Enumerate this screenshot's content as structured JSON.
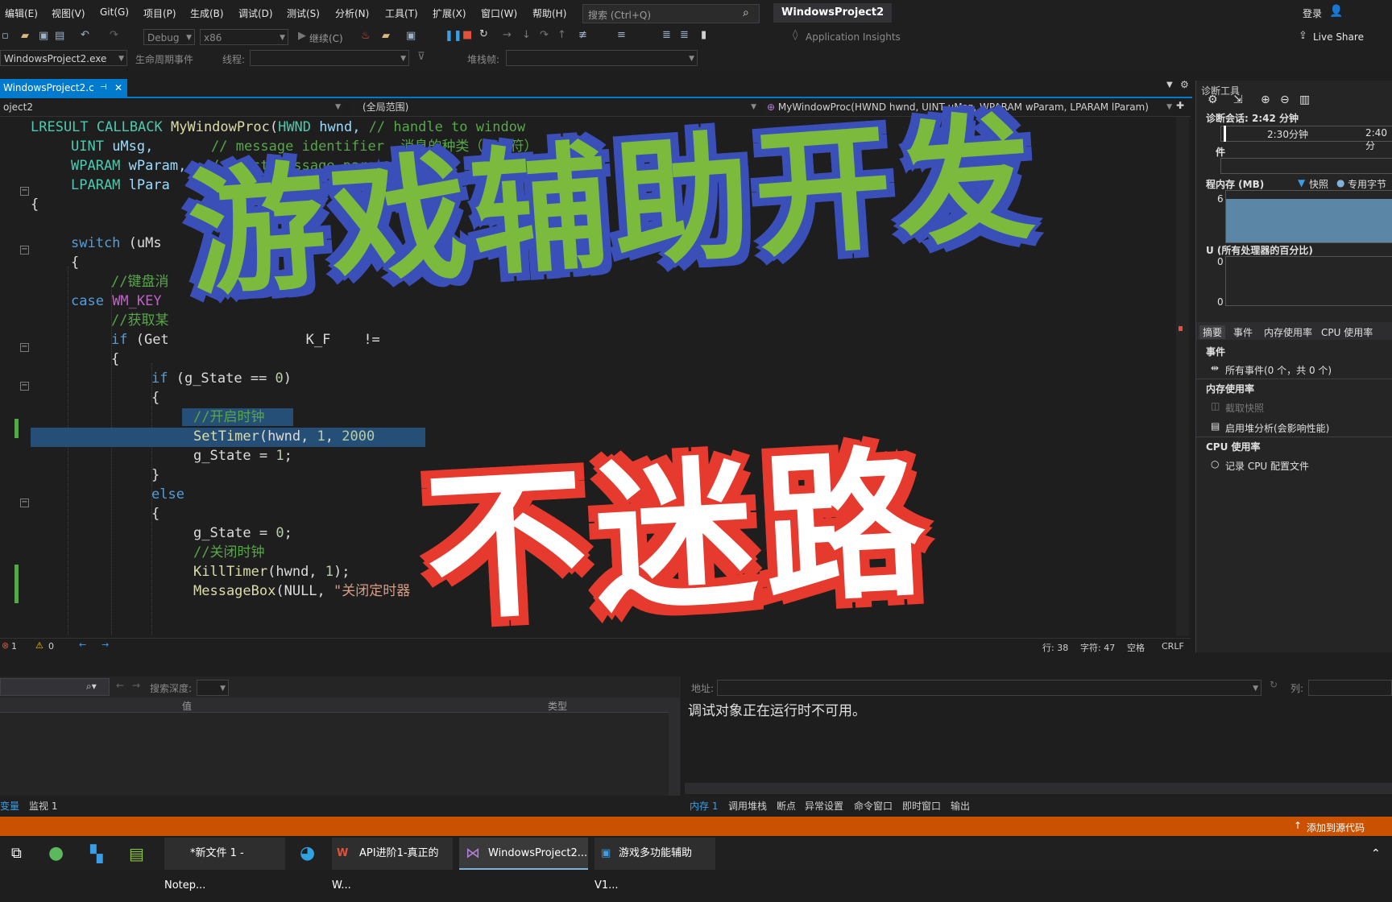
{
  "menu": [
    "编辑(E)",
    "视图(V)",
    "Git(G)",
    "项目(P)",
    "生成(B)",
    "调试(D)",
    "测试(S)",
    "分析(N)",
    "工具(T)",
    "扩展(X)",
    "窗口(W)",
    "帮助(H)"
  ],
  "search": {
    "placeholder": "搜索 (Ctrl+Q)"
  },
  "project_title": "WindowsProject2",
  "account": {
    "login": "登录",
    "live_share": "Live Share"
  },
  "toolbar": {
    "config": "Debug",
    "platform": "x86",
    "continue": "继续(C)",
    "app_insights": "Application Insights",
    "process": "WindowsProject2.exe",
    "lifecycle": "生命周期事件",
    "thread": "线程:",
    "stackframe": "堆栈帧:"
  },
  "editor": {
    "tab": "WindowsProject2.c",
    "nav_project": "oject2",
    "nav_scope": "(全局范围)",
    "nav_function": "MyWindowProc(HWND hwnd, UINT uMsg, WPARAM wParam, LPARAM lParam)",
    "lines": {
      "l1a": "LRESULT CALLBACK ",
      "l1b": "MyWindowProc",
      "l1c": "(",
      "l1d": "HWND",
      "l1e": " hwnd, ",
      "l1f": "// handle to window",
      "l2a": "UINT",
      "l2b": " uMsg,       ",
      "l2c": "// message identifier  消息的种类（标示符）",
      "l3a": "WPARAM",
      "l3b": " wParam,  ",
      "l3c": "// first message parameter",
      "l4a": "LPARAM",
      "l4b": " lPara",
      "l4c": "d messa",
      "l5": "{",
      "l6a": "switch",
      "l6b": " (uMs",
      "l7": "{",
      "l8": "//键盘消",
      "l9a": "case",
      "l9b": " WM_KEY",
      "l10": "//获取某",
      "l11a": "if",
      "l11b": " (Get",
      "l11c": "K_F    != ",
      "l12": "{",
      "l13a": "if",
      "l13b": " (g_State == ",
      "l13c": "0",
      "l13d": ")",
      "l14": "{",
      "l15": "//开启时钟",
      "l16a": "SetTimer",
      "l16b": "(hwnd, ",
      "l16c": "1",
      "l16d": ", ",
      "l16e": "2000",
      "l17a": "g_State = ",
      "l17b": "1",
      "l17c": ";",
      "l18": "}",
      "l19": "else",
      "l20": "{",
      "l21a": "g_State = ",
      "l21b": "0",
      "l21c": ";",
      "l22": "//关闭时钟",
      "l23a": "KillTimer",
      "l23b": "(hwnd, ",
      "l23c": "1",
      "l23d": ");",
      "l24a": "MessageBox",
      "l24b": "(NULL, ",
      "l24c": "\"关闭定时器"
    },
    "status": {
      "errors": "1",
      "warnings": "0",
      "line": "行: 38",
      "char": "字符: 47",
      "space": "空格",
      "eol": "CRLF"
    }
  },
  "diagnostics": {
    "title": "诊断工具",
    "session": "诊断会话: 2:42 分钟",
    "t1": "2:30分钟",
    "t2": "2:40分",
    "events": "件",
    "memory": "程内存 (MB)",
    "snapshot": "快照",
    "private_bytes": "专用字节",
    "mem_tick": "6",
    "cpu": "U (所有处理器的百分比)",
    "cpu_tick_top": "0",
    "cpu_tick_bottom": "0",
    "tabs": [
      "摘要",
      "事件",
      "内存使用率",
      "CPU 使用率"
    ],
    "sec_events": "事件",
    "all_events": "所有事件(0 个，共 0 个)",
    "sec_memory": "内存使用率",
    "take_snapshot": "截取快照",
    "heap_analysis": "启用堆分析(会影响性能)",
    "sec_cpu": "CPU 使用率",
    "record_cpu": "记录 CPU 配置文件"
  },
  "locals": {
    "search_depth": "搜索深度:",
    "col_value": "值",
    "col_type": "类型"
  },
  "memory": {
    "address": "地址:",
    "column": "列:",
    "message": "调试对象正在运行时不可用。"
  },
  "bottom_tabs_left": [
    "变量",
    "监视 1"
  ],
  "bottom_tabs_right": [
    "内存 1",
    "调用堆栈",
    "断点",
    "异常设置",
    "命令窗口",
    "即时窗口",
    "输出"
  ],
  "statusbar": {
    "source_control": "添加到源代码"
  },
  "taskbar": [
    "*新文件 1 - Notep...",
    "API进阶1-真正的W...",
    "WindowsProject2...",
    "游戏多功能辅助 V1..."
  ],
  "overlay": {
    "line1": "游戏辅助开发",
    "line2": "不迷路"
  },
  "colors": {
    "accent": "#007acc",
    "status": "#ca5100",
    "title_green": "#7cba3d",
    "title_blue": "#3b4fb8",
    "title_red": "#e53a2d"
  }
}
